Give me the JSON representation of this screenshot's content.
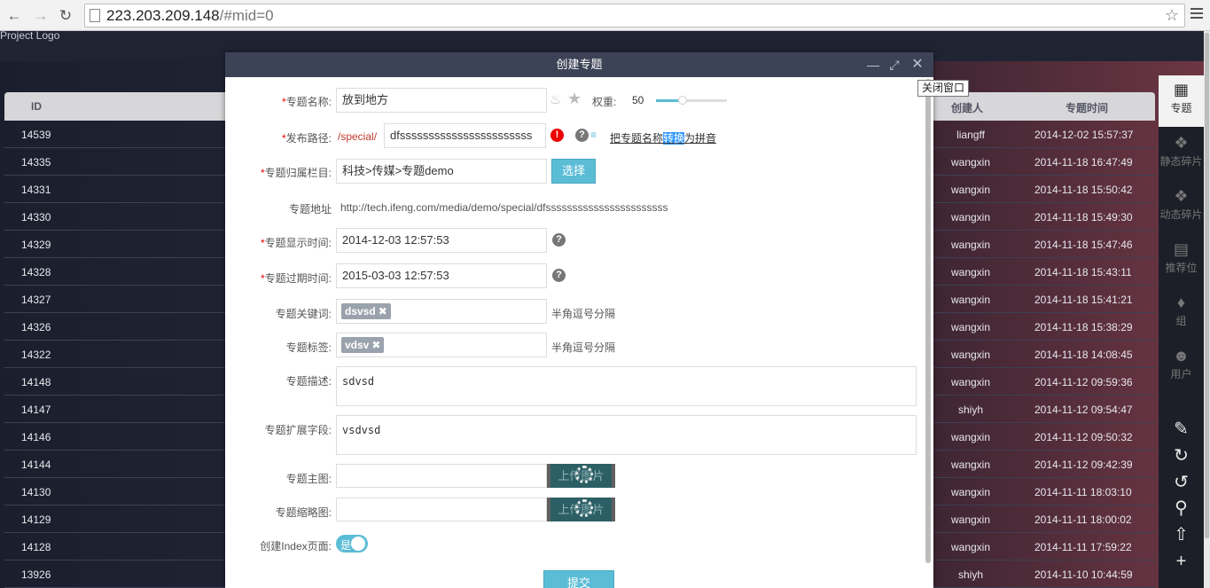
{
  "browser": {
    "url_host": "223.203.209.148",
    "url_path": "/#mid=0"
  },
  "app": {
    "logo": "Project Logo"
  },
  "table": {
    "headers": {
      "id": "ID",
      "creator": "创建人",
      "time": "专题时间"
    },
    "rows": [
      {
        "id": "14539",
        "user": "liangff",
        "time": "2014-12-02 15:57:37"
      },
      {
        "id": "14335",
        "user": "wangxin",
        "time": "2014-11-18 16:47:49"
      },
      {
        "id": "14331",
        "user": "wangxin",
        "time": "2014-11-18 15:50:42"
      },
      {
        "id": "14330",
        "user": "wangxin",
        "time": "2014-11-18 15:49:30"
      },
      {
        "id": "14329",
        "user": "wangxin",
        "time": "2014-11-18 15:47:46"
      },
      {
        "id": "14328",
        "user": "wangxin",
        "time": "2014-11-18 15:43:11"
      },
      {
        "id": "14327",
        "user": "wangxin",
        "time": "2014-11-18 15:41:21"
      },
      {
        "id": "14326",
        "user": "wangxin",
        "time": "2014-11-18 15:38:29"
      },
      {
        "id": "14322",
        "user": "wangxin",
        "time": "2014-11-18 14:08:45"
      },
      {
        "id": "14148",
        "user": "wangxin",
        "time": "2014-11-12 09:59:36"
      },
      {
        "id": "14147",
        "user": "shiyh",
        "time": "2014-11-12 09:54:47"
      },
      {
        "id": "14146",
        "user": "wangxin",
        "time": "2014-11-12 09:50:32"
      },
      {
        "id": "14144",
        "user": "wangxin",
        "time": "2014-11-12 09:42:39"
      },
      {
        "id": "14130",
        "user": "wangxin",
        "time": "2014-11-11 18:03:10"
      },
      {
        "id": "14129",
        "user": "wangxin",
        "time": "2014-11-11 18:00:02"
      },
      {
        "id": "14128",
        "user": "wangxin",
        "time": "2014-11-11 17:59:22"
      },
      {
        "id": "13926",
        "user": "shiyh",
        "time": "2014-11-10 10:44:59"
      }
    ]
  },
  "sidebar": {
    "items": [
      {
        "label": "专题",
        "icon": "grid-icon"
      },
      {
        "label": "静态碎片",
        "icon": "puzzle-icon"
      },
      {
        "label": "动态碎片",
        "icon": "puzzle-link-icon"
      },
      {
        "label": "推荐位",
        "icon": "layout-icon"
      },
      {
        "label": "组",
        "icon": "tag-icon"
      },
      {
        "label": "用户",
        "icon": "users-icon"
      }
    ],
    "tools": [
      "edit-icon",
      "refresh-icon",
      "redo-icon",
      "search-icon",
      "upload-icon",
      "add-icon"
    ]
  },
  "tooltip": "关闭窗口",
  "modal": {
    "title": "创建专题",
    "name": {
      "label": "专题名称:",
      "value": "放到地方",
      "weight_label": "权重:",
      "weight_value": "50",
      "weight_fraction": 0.38
    },
    "path": {
      "label": "发布路径:",
      "prefix": "/special/",
      "value": "dfsssssssssssssssssssssss",
      "link_pre": "把专题名称",
      "link_sel": "转换",
      "link_post": "为拼音"
    },
    "category": {
      "label": "专题归属栏目:",
      "value": "科技>传媒>专题demo",
      "button": "选择"
    },
    "address": {
      "label": "专题地址",
      "value": "http://tech.ifeng.com/media/demo/special/dfsssssssssssssssssssssss"
    },
    "show_time": {
      "label": "专题显示时间:",
      "value": "2014-12-03 12:57:53"
    },
    "expire_time": {
      "label": "专题过期时间:",
      "value": "2015-03-03 12:57:53"
    },
    "keywords": {
      "label": "专题关键词:",
      "tag": "dsvsd",
      "hint": "半角逗号分隔"
    },
    "tags": {
      "label": "专题标签:",
      "tag": "vdsv",
      "hint": "半角逗号分隔"
    },
    "desc": {
      "label": "专题描述:",
      "value": "sdvsd"
    },
    "ext": {
      "label": "专题扩展字段:",
      "value": "vsdvsd"
    },
    "main_image": {
      "label": "专题主图:",
      "button": "上传图片"
    },
    "thumb_image": {
      "label": "专题缩略图:",
      "button": "上传图片"
    },
    "index_page": {
      "label": "创建Index页面:",
      "toggle": "是"
    },
    "submit": "提交"
  }
}
